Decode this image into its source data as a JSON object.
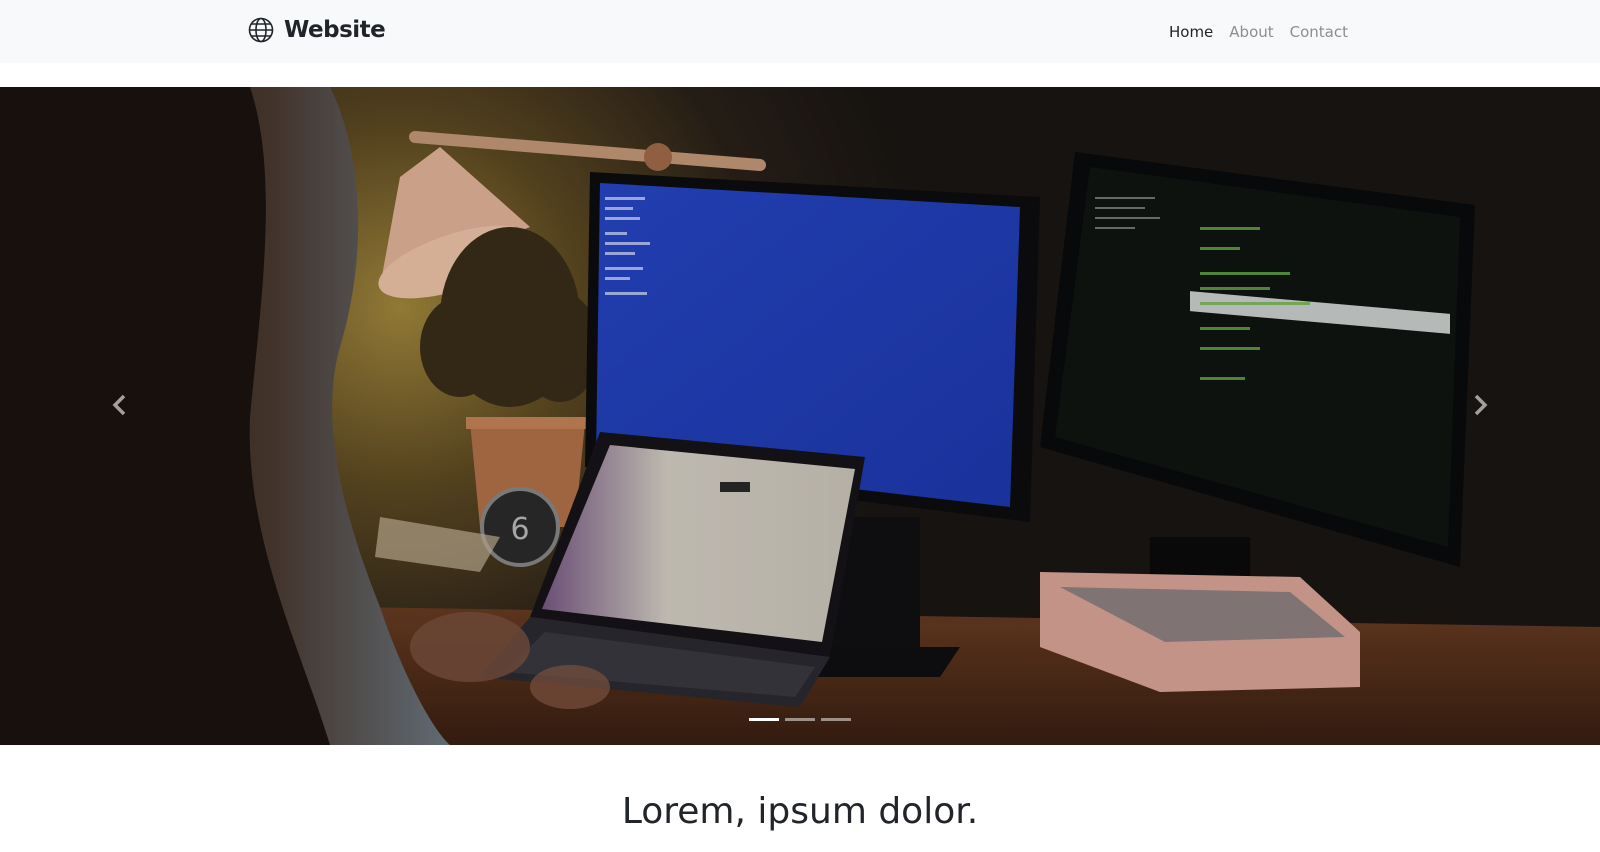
{
  "navbar": {
    "brand": {
      "icon": "globe-icon",
      "text": "Website"
    },
    "links": [
      {
        "label": "Home",
        "active": true
      },
      {
        "label": "About",
        "active": false
      },
      {
        "label": "Contact",
        "active": false
      }
    ]
  },
  "carousel": {
    "slide_count": 3,
    "active_slide": 1,
    "prev_icon": "chevron-left-icon",
    "next_icon": "chevron-right-icon"
  },
  "content": {
    "heading": "Lorem, ipsum dolor."
  },
  "colors": {
    "navbar_bg": "#f8f9fa",
    "text_dark": "#212529",
    "text_muted": "#8a8f94"
  }
}
